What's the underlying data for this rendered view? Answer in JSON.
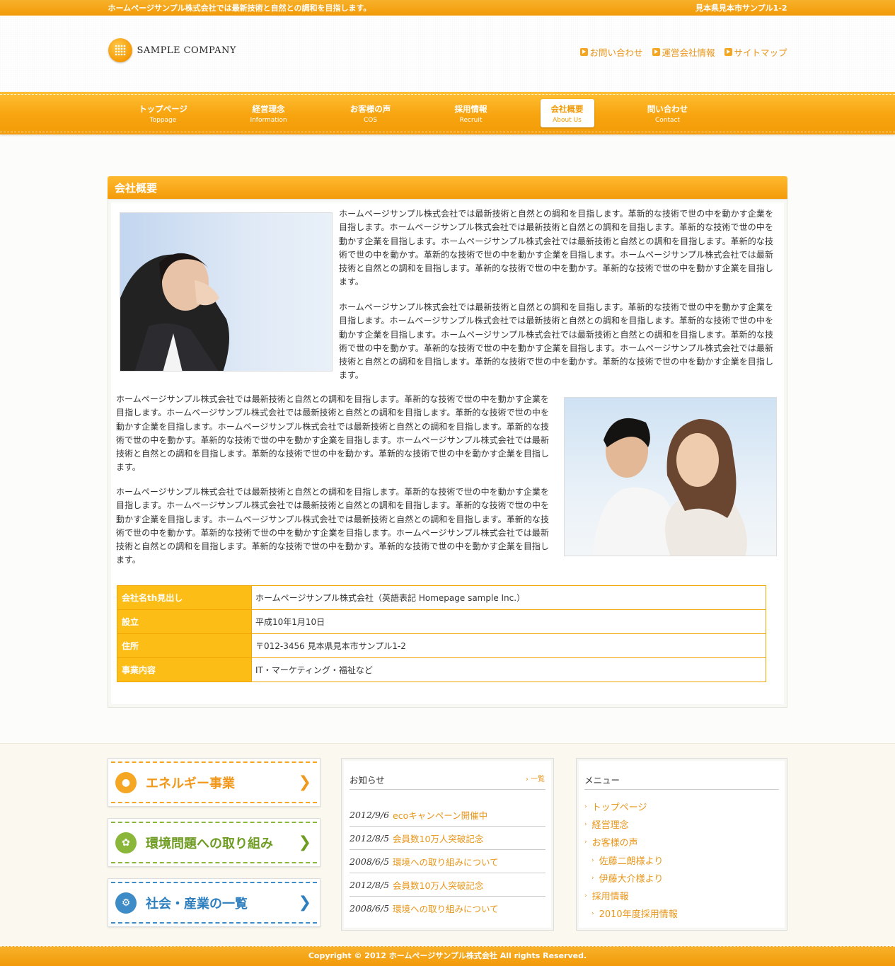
{
  "topbar": {
    "tagline": "ホームページサンプル株式会社では最新技術と自然との調和を目指します。",
    "address": "見本県見本市サンプル1-2"
  },
  "header": {
    "logo_text": "SAMPLE COMPANY",
    "links": [
      "お問い合わせ",
      "運営会社情報",
      "サイトマップ"
    ]
  },
  "nav": {
    "items": [
      {
        "jp": "トップページ",
        "en": "Toppage"
      },
      {
        "jp": "経営理念",
        "en": "Information"
      },
      {
        "jp": "お客様の声",
        "en": "COS"
      },
      {
        "jp": "採用情報",
        "en": "Recruit"
      },
      {
        "jp": "会社概要",
        "en": "About Us"
      },
      {
        "jp": "問い合わせ",
        "en": "Contact"
      }
    ],
    "active": "会社概要"
  },
  "main": {
    "heading": "会社概要",
    "paragraphs": [
      "ホームページサンプル株式会社では最新技術と自然との調和を目指します。革新的な技術で世の中を動かす企業を目指します。ホームページサンプル株式会社では最新技術と自然との調和を目指します。革新的な技術で世の中を動かす企業を目指します。ホームページサンプル株式会社では最新技術と自然との調和を目指します。革新的な技術で世の中を動かす。革新的な技術で世の中を動かす企業を目指します。ホームページサンプル株式会社では最新技術と自然との調和を目指します。革新的な技術で世の中を動かす。革新的な技術で世の中を動かす企業を目指します。",
      "ホームページサンプル株式会社では最新技術と自然との調和を目指します。革新的な技術で世の中を動かす企業を目指します。ホームページサンプル株式会社では最新技術と自然との調和を目指します。革新的な技術で世の中を動かす企業を目指します。ホームページサンプル株式会社では最新技術と自然との調和を目指します。革新的な技術で世の中を動かす。革新的な技術で世の中を動かす企業を目指します。ホームページサンプル株式会社では最新技術と自然との調和を目指します。革新的な技術で世の中を動かす。革新的な技術で世の中を動かす企業を目指します。",
      "ホームページサンプル株式会社では最新技術と自然との調和を目指します。革新的な技術で世の中を動かす企業を目指します。ホームページサンプル株式会社では最新技術と自然との調和を目指します。革新的な技術で世の中を動かす企業を目指します。ホームページサンプル株式会社では最新技術と自然との調和を目指します。革新的な技術で世の中を動かす。革新的な技術で世の中を動かす企業を目指します。ホームページサンプル株式会社では最新技術と自然との調和を目指します。革新的な技術で世の中を動かす。革新的な技術で世の中を動かす企業を目指します。",
      "ホームページサンプル株式会社では最新技術と自然との調和を目指します。革新的な技術で世の中を動かす企業を目指します。ホームページサンプル株式会社では最新技術と自然との調和を目指します。革新的な技術で世の中を動かす企業を目指します。ホームページサンプル株式会社では最新技術と自然との調和を目指します。革新的な技術で世の中を動かす。革新的な技術で世の中を動かす企業を目指します。ホームページサンプル株式会社では最新技術と自然との調和を目指します。革新的な技術で世の中を動かす。革新的な技術で世の中を動かす企業を目指します。"
    ],
    "table": [
      {
        "th": "会社名th見出し",
        "td": "ホームページサンプル株式会社（英語表記 Homepage sample Inc.）"
      },
      {
        "th": "設立",
        "td": "平成10年1月10日"
      },
      {
        "th": "住所",
        "td": "〒012-3456 見本県見本市サンプル1-2"
      },
      {
        "th": "事業内容",
        "td": "IT・マーケティング・福祉など"
      }
    ]
  },
  "banners": [
    {
      "label": "エネルギー事業",
      "icon": "lightbulb-icon",
      "color": "#f5a623"
    },
    {
      "label": "環境問題への取り組み",
      "icon": "leaf-icon",
      "color": "#8ab63a"
    },
    {
      "label": "社会・産業の一覧",
      "icon": "gear-icon",
      "color": "#3d8cc8"
    }
  ],
  "news": {
    "title": "お知らせ",
    "more": "一覧",
    "items": [
      {
        "date": "2012/9/6",
        "title": "ecoキャンペーン開催中"
      },
      {
        "date": "2012/8/5",
        "title": "会員数10万人突破記念"
      },
      {
        "date": "2008/6/5",
        "title": "環境への取り組みについて"
      },
      {
        "date": "2012/8/5",
        "title": "会員数10万人突破記念"
      },
      {
        "date": "2008/6/5",
        "title": "環境への取り組みについて"
      }
    ]
  },
  "menu": {
    "title": "メニュー",
    "items": [
      {
        "label": "トップページ",
        "level": 0
      },
      {
        "label": "経営理念",
        "level": 0
      },
      {
        "label": "お客様の声",
        "level": 0
      },
      {
        "label": "佐藤二朗様より",
        "level": 1
      },
      {
        "label": "伊藤大介様より",
        "level": 1
      },
      {
        "label": "採用情報",
        "level": 0
      },
      {
        "label": "2010年度採用情報",
        "level": 1
      }
    ]
  },
  "footer": {
    "copyright": "Copyright © 2012 ホームページサンプル株式会社 All rights Reserved."
  },
  "colors": {
    "accent": "#f39b0a",
    "link": "#e8961a",
    "table_header": "#fbbd16"
  }
}
